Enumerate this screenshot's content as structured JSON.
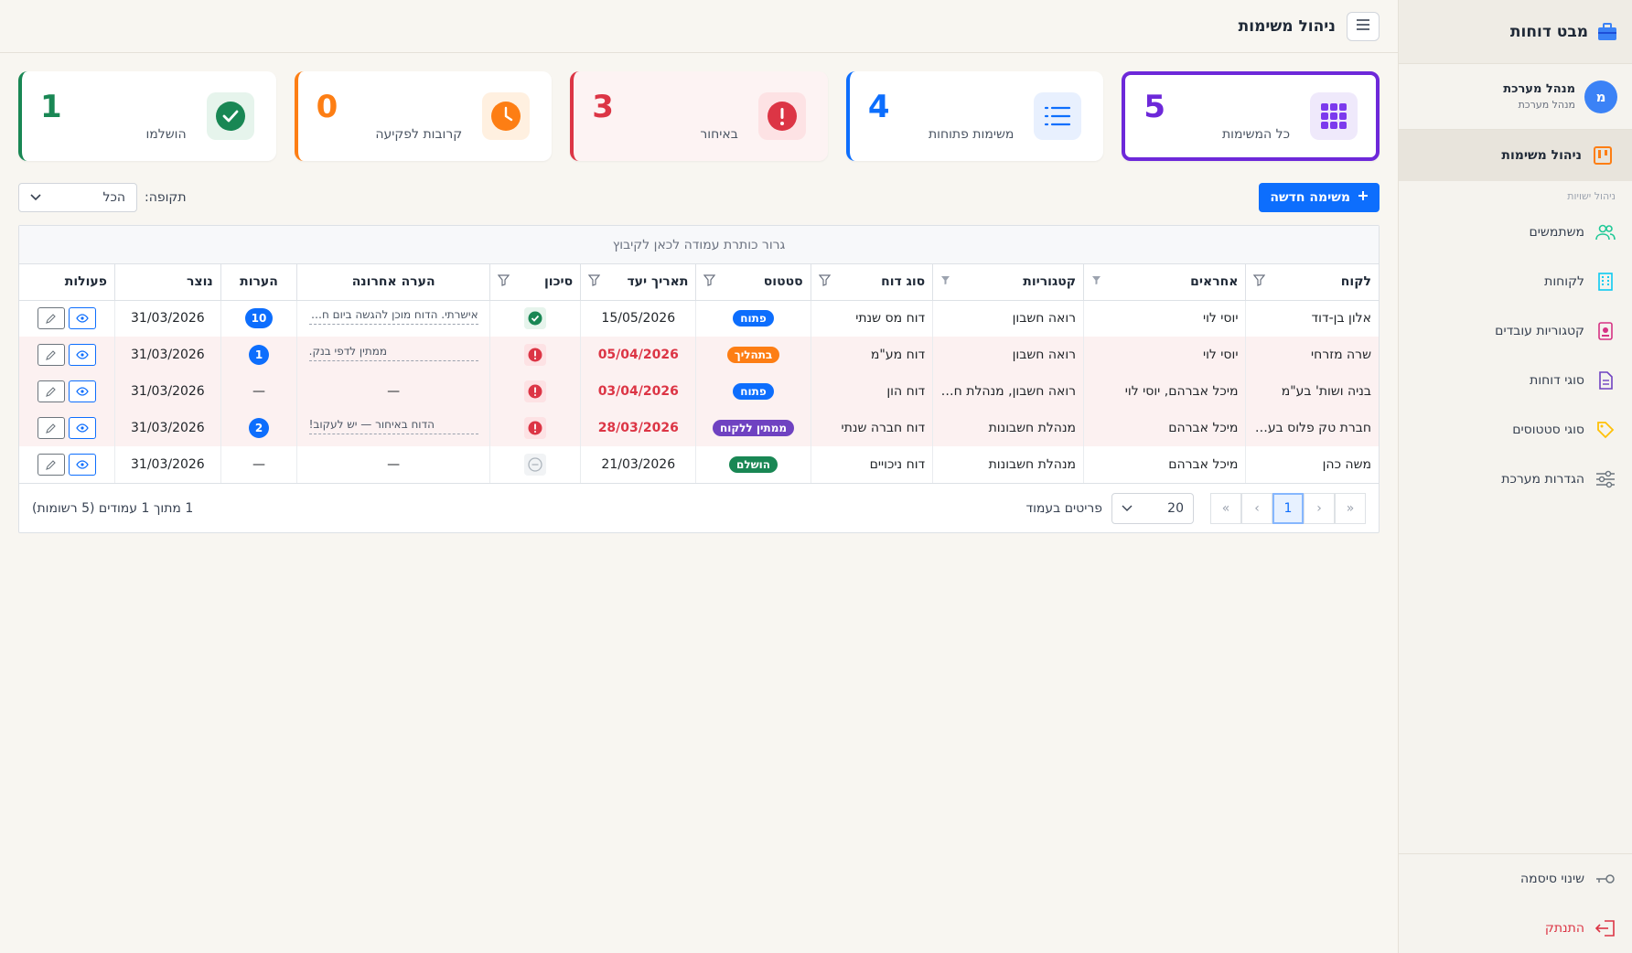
{
  "sidebar": {
    "brand": "מבט דוחות",
    "user_name": "מנהל מערכת",
    "user_role": "מנהל מערכת",
    "avatar_letter": "מ",
    "active_item": "ניהול משימות",
    "section_label": "ניהול ישויות",
    "items": [
      {
        "label": "משתמשים",
        "icon": "users-icon"
      },
      {
        "label": "לקוחות",
        "icon": "building-icon"
      },
      {
        "label": "קטגוריות עובדים",
        "icon": "badge-icon"
      },
      {
        "label": "סוגי דוחות",
        "icon": "document-icon"
      },
      {
        "label": "סוגי סטטוסים",
        "icon": "tag-icon"
      },
      {
        "label": "הגדרות מערכת",
        "icon": "sliders-icon"
      }
    ],
    "change_password": "שינוי סיסמה",
    "logout": "התנתק"
  },
  "header": {
    "title": "ניהול משימות"
  },
  "cards": [
    {
      "value": "5",
      "label": "כל המשימות",
      "color": "#6d28d9"
    },
    {
      "value": "4",
      "label": "משימות פתוחות",
      "color": "#0d6efd"
    },
    {
      "value": "3",
      "label": "באיחור",
      "color": "#dc3545"
    },
    {
      "value": "0",
      "label": "קרובות לפקיעה",
      "color": "#fd7e14"
    },
    {
      "value": "1",
      "label": "הושלמו",
      "color": "#198754"
    }
  ],
  "toolbar": {
    "new_task": "משימה חדשה",
    "period_label": "תקופה:",
    "period_value": "הכל"
  },
  "grid": {
    "group_hint": "גרור כותרת עמודה לכאן לקיבוץ",
    "columns": [
      "לקוח",
      "אחראים",
      "קטגוריות",
      "סוג דוח",
      "סטטוס",
      "תאריך יעד",
      "סיכון",
      "הערה אחרונה",
      "הערות",
      "נוצר",
      "פעולות"
    ],
    "rows": [
      {
        "client": "אלון בן-דוד",
        "owners": "יוסי לוי",
        "categories": "רואה חשבון",
        "report_type": "דוח מס שנתי",
        "status": "פתוח",
        "due": "15/05/2026",
        "risk": "ok",
        "last_comment": "אישרתי. הדוח מוכן להגשה ביום חמישי.",
        "comments": "10",
        "created": "31/03/2026",
        "late": false
      },
      {
        "client": "שרה מזרחי",
        "owners": "יוסי לוי",
        "categories": "רואה חשבון",
        "report_type": "דוח מע\"מ",
        "status": "בתהליך",
        "due": "05/04/2026",
        "risk": "late",
        "last_comment": "ממתין לדפי בנק.",
        "comments": "1",
        "created": "31/03/2026",
        "late": true
      },
      {
        "client": "בניה ושות' בע\"מ",
        "owners": "מיכל אברהם, יוסי לוי",
        "categories": "רואה חשבון, מנהלת חשבונות",
        "report_type": "דוח הון",
        "status": "פתוח",
        "due": "03/04/2026",
        "risk": "late",
        "last_comment": "—",
        "comments": "—",
        "created": "31/03/2026",
        "late": true
      },
      {
        "client": "חברת טק פלוס בע\"מ",
        "owners": "מיכל אברהם",
        "categories": "מנהלת חשבונות",
        "report_type": "דוח חברה שנתי",
        "status": "ממתין ללקוח",
        "due": "28/03/2026",
        "risk": "late",
        "last_comment": "הדוח באיחור — יש לעקוב!",
        "comments": "2",
        "created": "31/03/2026",
        "late": true
      },
      {
        "client": "משה כהן",
        "owners": "מיכל אברהם",
        "categories": "מנהלת חשבונות",
        "report_type": "דוח ניכויים",
        "status": "הושלם",
        "due": "21/03/2026",
        "risk": "none",
        "last_comment": "—",
        "comments": "—",
        "created": "31/03/2026",
        "late": false
      }
    ],
    "page_current": "1",
    "page_size": "20",
    "page_size_label": "פריטים בעמוד",
    "summary": "1 מתוך 1 עמודים (5 רשומות)"
  }
}
